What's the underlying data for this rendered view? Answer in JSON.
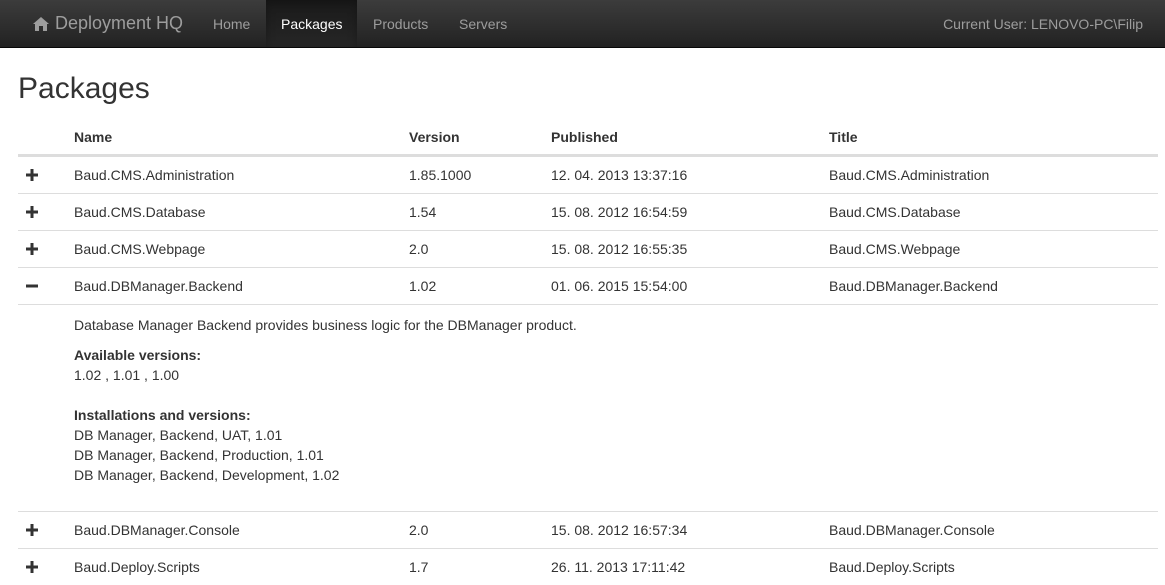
{
  "navbar": {
    "brand": "Deployment HQ",
    "links": [
      {
        "label": "Home"
      },
      {
        "label": "Packages"
      },
      {
        "label": "Products"
      },
      {
        "label": "Servers"
      }
    ],
    "current_user": "Current User: LENOVO-PC\\Filip"
  },
  "page": {
    "title": "Packages"
  },
  "table": {
    "columns": {
      "name": "Name",
      "version": "Version",
      "published": "Published",
      "title": "Title"
    },
    "rows": [
      {
        "toggle": "plus",
        "name": "Baud.CMS.Administration",
        "version": "1.85.1000",
        "published": "12. 04. 2013 13:37:16",
        "title": "Baud.CMS.Administration"
      },
      {
        "toggle": "plus",
        "name": "Baud.CMS.Database",
        "version": "1.54",
        "published": "15. 08. 2012 16:54:59",
        "title": "Baud.CMS.Database"
      },
      {
        "toggle": "plus",
        "name": "Baud.CMS.Webpage",
        "version": "2.0",
        "published": "15. 08. 2012 16:55:35",
        "title": "Baud.CMS.Webpage"
      },
      {
        "toggle": "minus",
        "name": "Baud.DBManager.Backend",
        "version": "1.02",
        "published": "01. 06. 2015 15:54:00",
        "title": "Baud.DBManager.Backend"
      },
      {
        "toggle": "plus",
        "name": "Baud.DBManager.Console",
        "version": "2.0",
        "published": "15. 08. 2012 16:57:34",
        "title": "Baud.DBManager.Console"
      },
      {
        "toggle": "plus",
        "name": "Baud.Deploy.Scripts",
        "version": "1.7",
        "published": "26. 11. 2013 17:11:42",
        "title": "Baud.Deploy.Scripts"
      }
    ]
  },
  "details": {
    "description": "Database Manager Backend provides business logic for the DBManager product.",
    "available_label": "Available versions:",
    "available_versions": "1.02 , 1.01 , 1.00",
    "installations_label": "Installations and versions:",
    "installations": [
      "DB Manager, Backend, UAT, 1.01",
      "DB Manager, Backend, Production, 1.01",
      "DB Manager, Backend, Development, 1.02"
    ]
  }
}
